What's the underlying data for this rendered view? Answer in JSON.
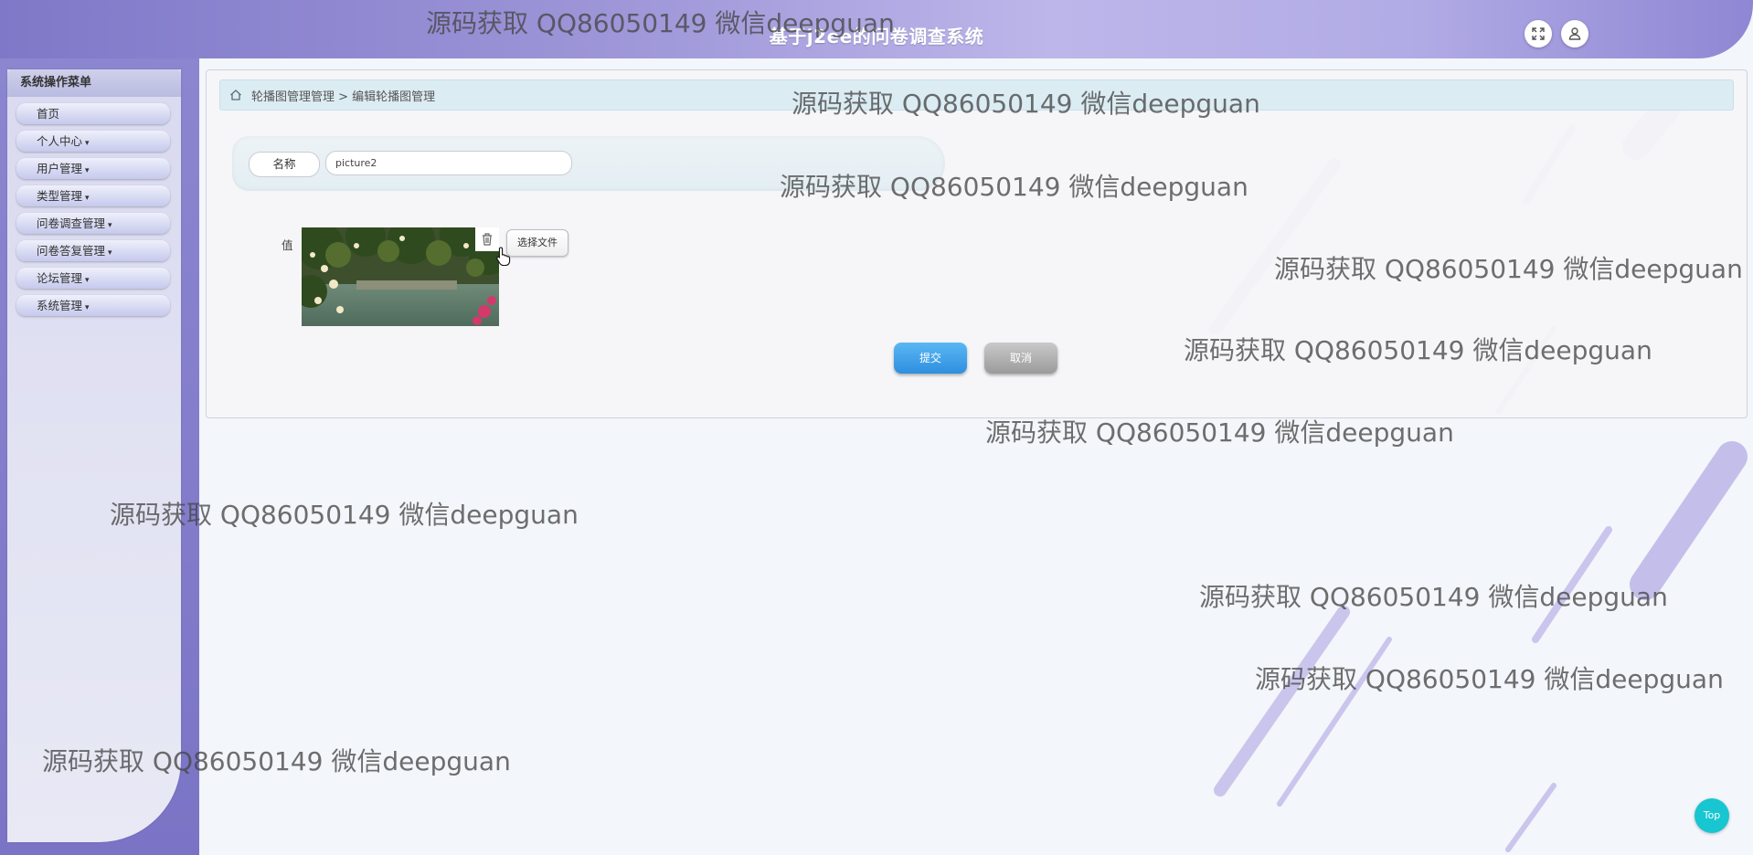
{
  "header": {
    "title": "基于j2ee的问卷调查系统",
    "fullscreen_icon": "fullscreen-icon",
    "user_icon": "user-icon"
  },
  "sidebar": {
    "title": "系统操作菜单",
    "items": [
      {
        "label": "首页",
        "caret": ""
      },
      {
        "label": "个人中心",
        "caret": "▾"
      },
      {
        "label": "用户管理",
        "caret": "▾"
      },
      {
        "label": "类型管理",
        "caret": "▾"
      },
      {
        "label": "问卷调查管理",
        "caret": "▾"
      },
      {
        "label": "问卷答复管理",
        "caret": "▾"
      },
      {
        "label": "论坛管理",
        "caret": "▾"
      },
      {
        "label": "系统管理",
        "caret": "▾"
      }
    ]
  },
  "breadcrumb": {
    "home_icon": "home-icon",
    "path": "轮播图管理管理 > 编辑轮播图管理"
  },
  "form": {
    "name_label": "名称",
    "name_value": "picture2",
    "value_label": "值",
    "delete_icon": "trash-icon",
    "choose_file_label": "选择文件",
    "submit_label": "提交",
    "cancel_label": "取消"
  },
  "top_button": {
    "label": "Top"
  },
  "watermarks": [
    "源码获取 QQ86050149 微信deepguan",
    "源码获取 QQ86050149 微信deepguan",
    "源码获取 QQ86050149 微信deepguan",
    "源码获取 QQ86050149 微信deepguan",
    "源码获取 QQ86050149 微信deepguan",
    "源码获取 QQ86050149 微信deepguan",
    "源码获取 QQ86050149 微信deepguan",
    "源码获取 QQ86050149 微信deepguan",
    "源码获取 QQ86050149 微信deepguan",
    "源码获取 QQ86050149 微信deepguan"
  ]
}
